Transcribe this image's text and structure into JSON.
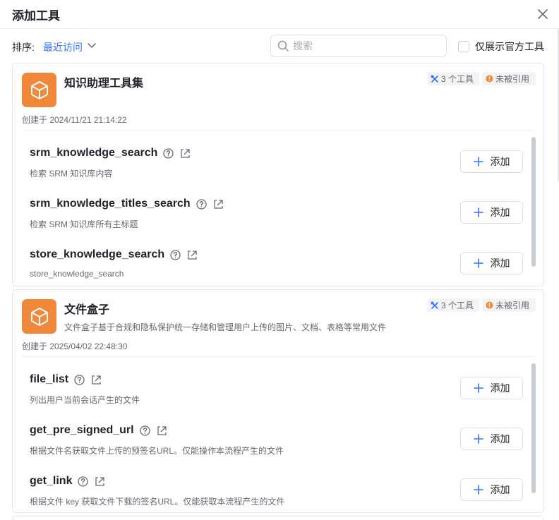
{
  "dialog": {
    "title": "添加工具"
  },
  "toolbar": {
    "sort_label": "排序:",
    "sort_value": "最近访问",
    "search_placeholder": "搜索",
    "official_only_label": "仅展示官方工具"
  },
  "colors": {
    "accent": "#3370ff",
    "group_icon_bg": "#f0883a",
    "unref_dot": "#f0883a"
  },
  "groups": [
    {
      "title": "知识助理工具集",
      "description": "",
      "created": "创建于 2024/11/21 21:14:22",
      "tool_count_badge": "3 个工具",
      "status_badge": "未被引用",
      "tools": [
        {
          "name": "srm_knowledge_search",
          "description": "检索 SRM 知识库内容",
          "add_label": "添加"
        },
        {
          "name": "srm_knowledge_titles_search",
          "description": "检索 SRM 知识库所有主标题",
          "add_label": "添加"
        },
        {
          "name": "store_knowledge_search",
          "description": "store_knowledge_search",
          "add_label": "添加"
        }
      ]
    },
    {
      "title": "文件盒子",
      "description": "文件盒子基于合规和隐私保护统一存储和管理用户上传的图片、文档、表格等常用文件",
      "created": "创建于 2025/04/02 22:48:30",
      "tool_count_badge": "3 个工具",
      "status_badge": "未被引用",
      "tools": [
        {
          "name": "file_list",
          "description": "列出用户当前会话产生的文件",
          "add_label": "添加"
        },
        {
          "name": "get_pre_signed_url",
          "description": "根据文件名获取文件上传的预签名URL。仅能操作本流程产生的文件",
          "add_label": "添加"
        },
        {
          "name": "get_link",
          "description": "根据文件 key 获取文件下载的签名URL。仅能获取本流程产生的文件",
          "add_label": "添加"
        }
      ]
    }
  ]
}
